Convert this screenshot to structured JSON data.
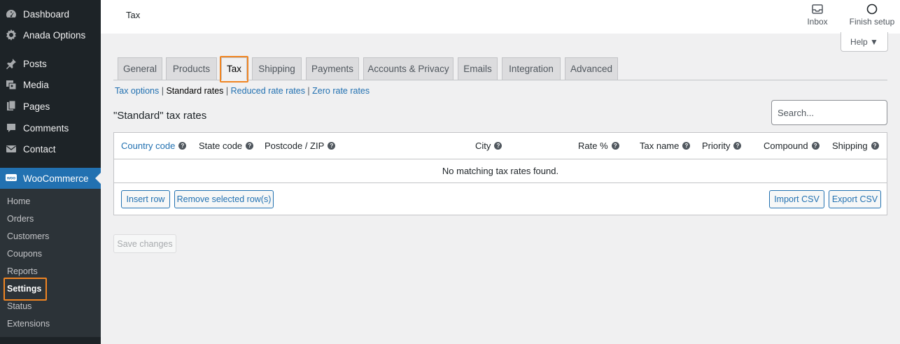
{
  "sidebar": {
    "menu": [
      {
        "label": "Dashboard",
        "icon": "dashboard-icon"
      },
      {
        "label": "Anada Options",
        "icon": "gear-icon"
      },
      {
        "label": "Posts",
        "icon": "pin-icon"
      },
      {
        "label": "Media",
        "icon": "media-icon"
      },
      {
        "label": "Pages",
        "icon": "pages-icon"
      },
      {
        "label": "Comments",
        "icon": "comment-icon"
      },
      {
        "label": "Contact",
        "icon": "mail-icon"
      },
      {
        "label": "WooCommerce",
        "icon": "woocommerce-icon"
      }
    ],
    "submenu": [
      "Home",
      "Orders",
      "Customers",
      "Coupons",
      "Reports",
      "Settings",
      "Status",
      "Extensions"
    ]
  },
  "topbar": {
    "title": "Tax",
    "inbox_label": "Inbox",
    "finish_setup_label": "Finish setup"
  },
  "help_label": "Help ▼",
  "tabs": [
    "General",
    "Products",
    "Tax",
    "Shipping",
    "Payments",
    "Accounts & Privacy",
    "Emails",
    "Integration",
    "Advanced"
  ],
  "active_tab": "Tax",
  "subnav": {
    "tax_options": "Tax options",
    "sep1": " | ",
    "standard": "Standard rates",
    "sep2": " | ",
    "reduced": "Reduced rate rates",
    "sep3": " | ",
    "zero": "Zero rate rates"
  },
  "section_title": "\"Standard\" tax rates",
  "search": {
    "placeholder": "Search..."
  },
  "table": {
    "columns": [
      "Country code",
      "State code",
      "Postcode / ZIP",
      "City",
      "Rate %",
      "Tax name",
      "Priority",
      "Compound",
      "Shipping"
    ],
    "empty_message": "No matching tax rates found.",
    "insert_row": "Insert row",
    "remove_rows": "Remove selected row(s)",
    "import_csv": "Import CSV",
    "export_csv": "Export CSV"
  },
  "save_changes": "Save changes",
  "colors": {
    "accent": "#2271b1",
    "highlight": "#f08522",
    "sidebar": "#1d2327"
  }
}
